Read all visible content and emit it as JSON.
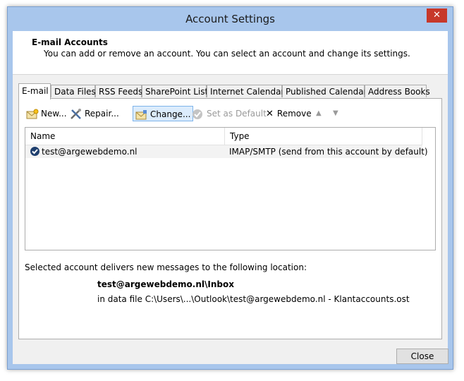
{
  "window": {
    "title": "Account Settings",
    "close_glyph": "✕"
  },
  "header": {
    "title": "E-mail Accounts",
    "description": "You can add or remove an account. You can select an account and change its settings."
  },
  "tabs": [
    {
      "label": "E-mail"
    },
    {
      "label": "Data Files"
    },
    {
      "label": "RSS Feeds"
    },
    {
      "label": "SharePoint Lists"
    },
    {
      "label": "Internet Calendars"
    },
    {
      "label": "Published Calendars"
    },
    {
      "label": "Address Books"
    }
  ],
  "toolbar": {
    "new_label": "New...",
    "repair_label": "Repair...",
    "change_label": "Change...",
    "set_default_label": "Set as Default",
    "remove_label": "Remove",
    "remove_glyph": "✕",
    "up_glyph": "▲",
    "down_glyph": "▼"
  },
  "accounts": {
    "columns": [
      "Name",
      "Type"
    ],
    "rows": [
      {
        "name": "test@argewebdemo.nl",
        "type": "IMAP/SMTP (send from this account by default)"
      }
    ]
  },
  "delivery": {
    "info": "Selected account delivers new messages to the following location:",
    "location": "test@argewebdemo.nl\\Inbox",
    "data_file": "in data file C:\\Users\\...\\Outlook\\test@argewebdemo.nl - Klantaccounts.ost"
  },
  "buttons": {
    "close_label": "Close"
  },
  "colors": {
    "titlebar": "#a8c6ec",
    "close_button": "#c7382a",
    "selection": "#dcecfc"
  }
}
